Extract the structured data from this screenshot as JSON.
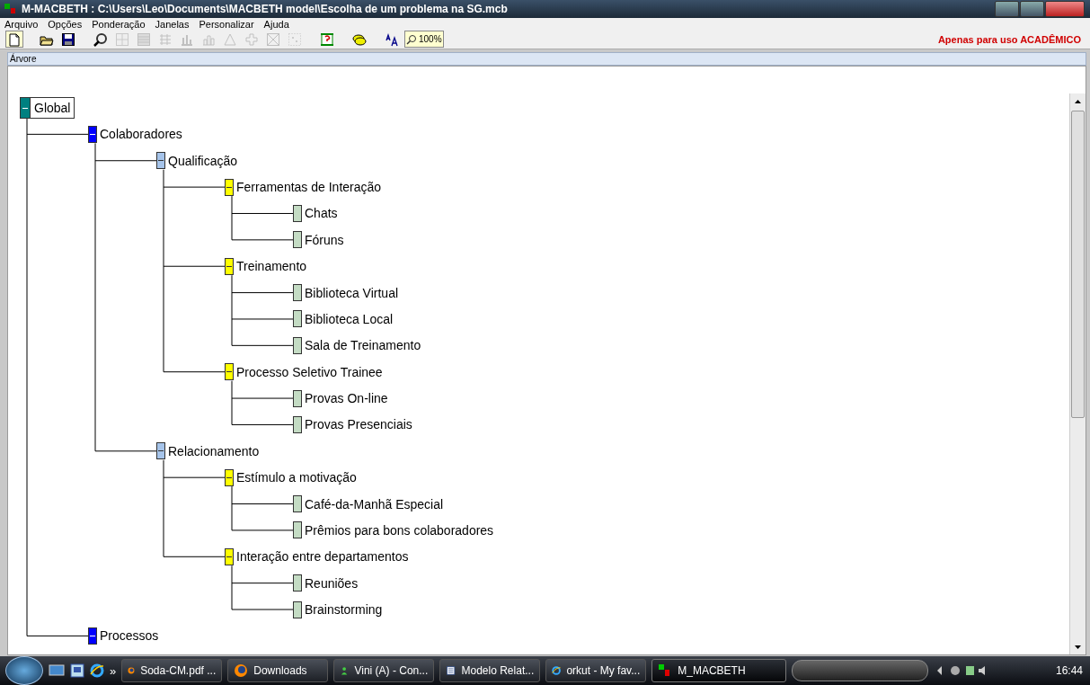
{
  "window": {
    "title": "M-MACBETH : C:\\Users\\Leo\\Documents\\MACBETH model\\Escolha de um problema na SG.mcb"
  },
  "menu": [
    "Arquivo",
    "Opções",
    "Ponderação",
    "Janelas",
    "Personalizar",
    "Ajuda"
  ],
  "toolbar": [
    {
      "kind": "new",
      "disabled": false
    },
    {
      "kind": "open",
      "disabled": false
    },
    {
      "kind": "save",
      "disabled": false
    },
    {
      "kind": "magnifier",
      "disabled": false
    },
    {
      "kind": "ab",
      "disabled": true
    },
    {
      "kind": "table",
      "disabled": true
    },
    {
      "kind": "columns",
      "disabled": true
    },
    {
      "kind": "bars",
      "disabled": true
    },
    {
      "kind": "chart",
      "disabled": true
    },
    {
      "kind": "triangle",
      "disabled": true
    },
    {
      "kind": "cross",
      "disabled": true
    },
    {
      "kind": "xbox",
      "disabled": true
    },
    {
      "kind": "dots",
      "disabled": true
    },
    {
      "kind": "help",
      "disabled": false
    },
    {
      "kind": "coins",
      "disabled": false
    },
    {
      "kind": "font",
      "disabled": false
    },
    {
      "kind": "zoom",
      "disabled": false,
      "label": "100%"
    }
  ],
  "license_note": "Apenas para uso ACADÊMICO",
  "panel": {
    "title": "Árvore"
  },
  "tree": [
    {
      "label": "Global",
      "color": "#008080",
      "expanded": true,
      "children": [
        {
          "label": "Colaboradores",
          "color": "#0000ff",
          "expanded": true,
          "children": [
            {
              "label": "Qualificação",
              "color": "#a6c4ea",
              "expanded": true,
              "children": [
                {
                  "label": "Ferramentas de Interação",
                  "color": "#ffff00",
                  "expanded": true,
                  "children": [
                    {
                      "label": "Chats",
                      "color": "#c4dcc4",
                      "expanded": false
                    },
                    {
                      "label": "Fóruns",
                      "color": "#c4dcc4",
                      "expanded": false
                    }
                  ]
                },
                {
                  "label": "Treinamento",
                  "color": "#ffff00",
                  "expanded": true,
                  "children": [
                    {
                      "label": "Biblioteca Virtual",
                      "color": "#c4dcc4",
                      "expanded": false
                    },
                    {
                      "label": "Biblioteca Local",
                      "color": "#c4dcc4",
                      "expanded": false
                    },
                    {
                      "label": "Sala de Treinamento",
                      "color": "#c4dcc4",
                      "expanded": false
                    }
                  ]
                },
                {
                  "label": "Processo Seletivo Trainee",
                  "color": "#ffff00",
                  "expanded": true,
                  "children": [
                    {
                      "label": "Provas On-line",
                      "color": "#c4dcc4",
                      "expanded": false
                    },
                    {
                      "label": "Provas Presenciais",
                      "color": "#c4dcc4",
                      "expanded": false
                    }
                  ]
                }
              ]
            },
            {
              "label": "Relacionamento",
              "color": "#a6c4ea",
              "expanded": true,
              "children": [
                {
                  "label": "Estímulo a motivação",
                  "color": "#ffff00",
                  "expanded": true,
                  "children": [
                    {
                      "label": "Café-da-Manhã Especial",
                      "color": "#c4dcc4",
                      "expanded": false
                    },
                    {
                      "label": "Prêmios para bons colaboradores",
                      "color": "#c4dcc4",
                      "expanded": false
                    }
                  ]
                },
                {
                  "label": "Interação entre departamentos",
                  "color": "#ffff00",
                  "expanded": true,
                  "children": [
                    {
                      "label": "Reuniões",
                      "color": "#c4dcc4",
                      "expanded": false
                    },
                    {
                      "label": "Brainstorming",
                      "color": "#c4dcc4",
                      "expanded": false
                    }
                  ]
                }
              ]
            }
          ]
        },
        {
          "label": "Processos",
          "color": "#0000ff",
          "expanded": true
        }
      ]
    }
  ],
  "taskbar": {
    "items": [
      {
        "label": "Soda-CM.pdf ...",
        "kind": "firefox",
        "selected": false
      },
      {
        "label": "Downloads",
        "kind": "firefox",
        "selected": false
      },
      {
        "label": "Vini (A) - Con...",
        "kind": "messenger",
        "selected": false
      },
      {
        "label": "Modelo Relat...",
        "kind": "word",
        "selected": false
      },
      {
        "label": "orkut - My fav...",
        "kind": "ie",
        "selected": false
      },
      {
        "label": "M_MACBETH",
        "kind": "macbeth",
        "selected": true
      }
    ],
    "quick_launch_more": "»",
    "clock": "16:44"
  }
}
